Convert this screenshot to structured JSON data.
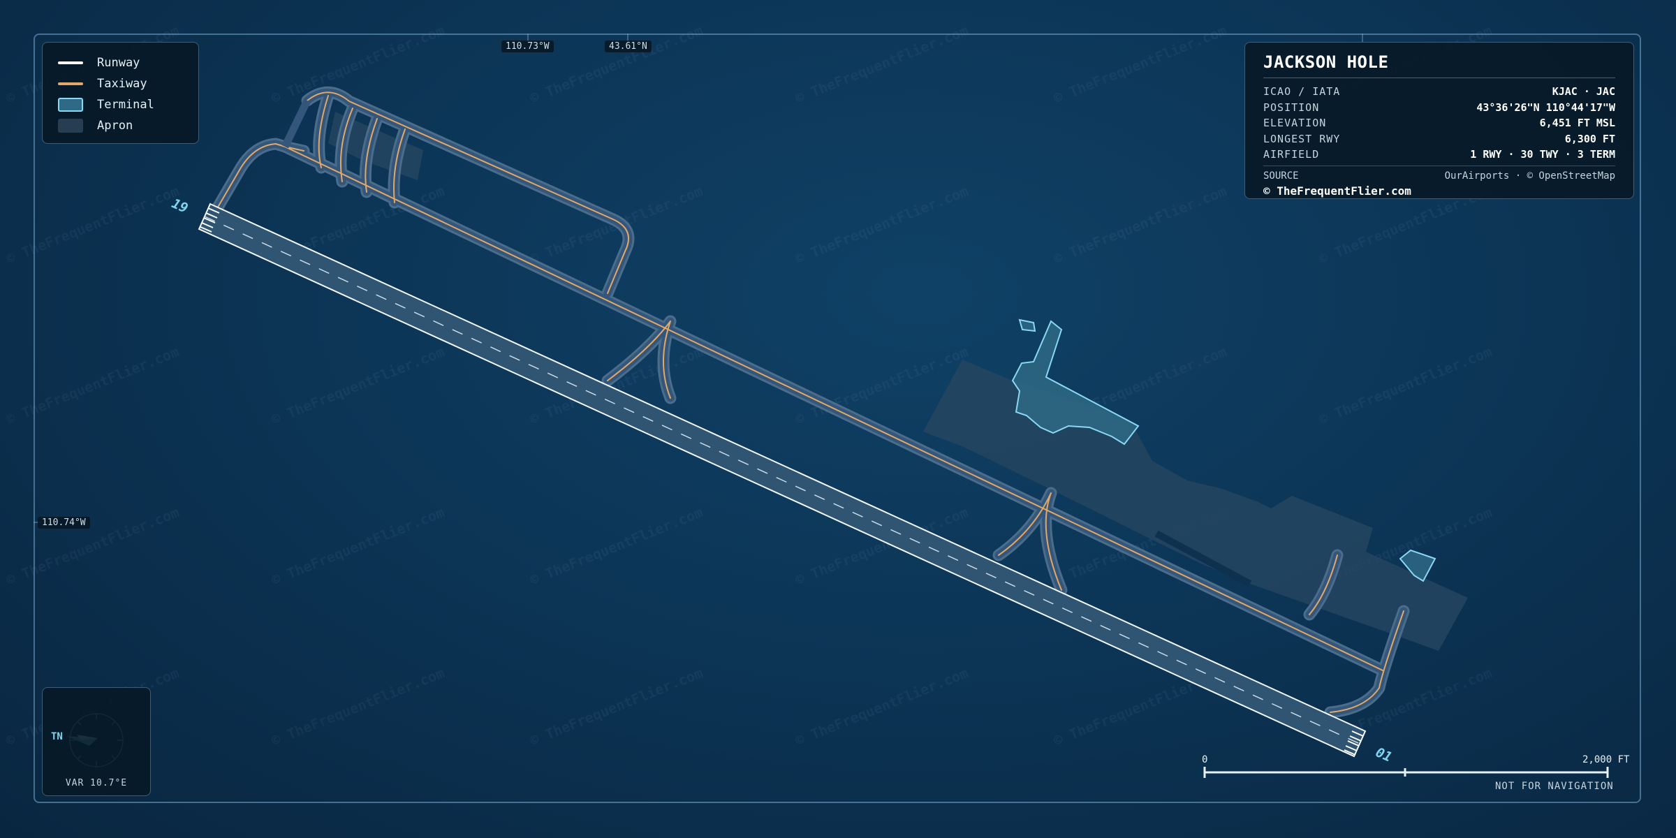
{
  "watermark": "© TheFrequentFlier.com",
  "legend": {
    "runway": "Runway",
    "taxiway": "Taxiway",
    "terminal": "Terminal",
    "apron": "Apron"
  },
  "info": {
    "name": "JACKSON HOLE",
    "rows": [
      {
        "key": "ICAO / IATA",
        "value": "KJAC · JAC"
      },
      {
        "key": "POSITION",
        "value": "43°36'26\"N 110°44'17\"W"
      },
      {
        "key": "ELEVATION",
        "value": "6,451 FT MSL"
      },
      {
        "key": "LONGEST RWY",
        "value": "6,300 FT"
      },
      {
        "key": "AIRFIELD",
        "value": "1 RWY · 30 TWY · 3 TERM"
      }
    ],
    "source_label": "SOURCE",
    "source_value": "OurAirports · © OpenStreetMap",
    "copyright": "© TheFrequentFlier.com"
  },
  "map": {
    "graticule": {
      "lon_top_1": "110.73°W",
      "lat_top": "43.61°N",
      "lon_left": "110.74°W"
    },
    "runway": {
      "end_north": "19",
      "end_south": "01"
    }
  },
  "compass": {
    "tn_label": "TN",
    "variation": "VAR 10.7°E"
  },
  "scale": {
    "start": "0",
    "end": "2,000 FT",
    "notice": "NOT FOR NAVIGATION"
  },
  "colors": {
    "background": "#0c3556",
    "runway_edge": "#ffffff",
    "taxiway_centerline": "#e1a969",
    "terminal_outline": "#8ad8f3",
    "apron": "#244560",
    "runway_label": "#7fd5ef"
  }
}
